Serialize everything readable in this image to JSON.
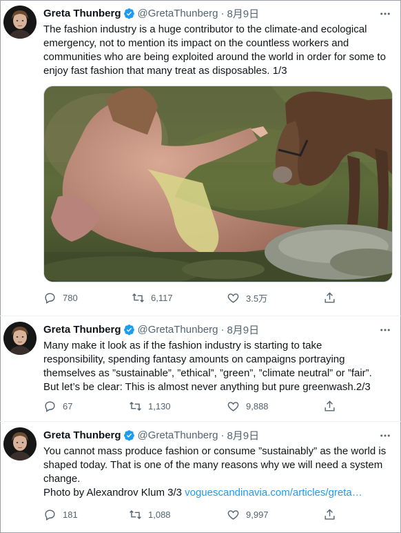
{
  "tweets": [
    {
      "name": "Greta Thunberg",
      "handle": "@GretaThunberg",
      "separator": "·",
      "date": "8月9日",
      "text": "The fashion industry is a huge contributor to the climate-and ecological\nemergency, not to mention its impact on the countless workers and\ncommunities who are being exploited around the world in order for some to\nenjoy fast fashion that many treat as disposables. 1/3",
      "replies": "780",
      "retweets": "6,117",
      "likes": "3.5万"
    },
    {
      "name": "Greta Thunberg",
      "handle": "@GretaThunberg",
      "separator": "·",
      "date": "8月9日",
      "text": "Many make it look as if the fashion industry is starting to take\nresponsibility, spending fantasy amounts on campaigns portraying\nthemselves as ”sustainable”, ”ethical”, ”green”, ”climate neutral” or ”fair”.\nBut let’s be clear: This is almost never anything but pure greenwash.2/3",
      "replies": "67",
      "retweets": "1,130",
      "likes": "9,888"
    },
    {
      "name": "Greta Thunberg",
      "handle": "@GretaThunberg",
      "separator": "·",
      "date": "8月9日",
      "text": "You cannot mass produce fashion or consume ”sustainably” as the world is\nshaped today. That is one of the many reasons why we will need a system\nchange.\nPhoto by Alexandrov Klum 3/3 ",
      "link": "voguescandinavia.com/articles/greta…",
      "replies": "181",
      "retweets": "1,088",
      "likes": "9,997"
    }
  ],
  "colors": {
    "link": "#1d9bf0",
    "verified": "#1d9bf0",
    "muted": "#536471"
  },
  "icons": [
    "verified-badge-icon",
    "more-icon",
    "reply-icon",
    "retweet-icon",
    "like-icon",
    "share-icon"
  ]
}
